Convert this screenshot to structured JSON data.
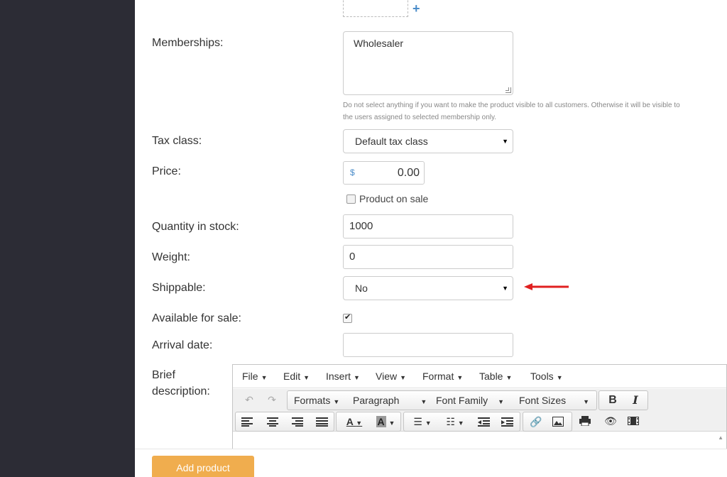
{
  "form": {
    "memberships_label": "Memberships:",
    "memberships_value": "Wholesaler",
    "memberships_hint": "Do not select anything if you want to make the product visible to all customers. Otherwise it will be visible to the users assigned to selected membership only.",
    "tax_class_label": "Tax class:",
    "tax_class_value": "Default tax class",
    "price_label": "Price:",
    "price_currency": "$",
    "price_value": "0.00",
    "on_sale_label": "Product on sale",
    "quantity_label": "Quantity in stock:",
    "quantity_value": "1000",
    "weight_label": "Weight:",
    "weight_value": "0",
    "shippable_label": "Shippable:",
    "shippable_value": "No",
    "available_label": "Available for sale:",
    "arrival_label": "Arrival date:",
    "arrival_value": "",
    "brief_label_line1": "Brief",
    "brief_label_line2": "description:",
    "add_image_symbol": "+"
  },
  "editor": {
    "menu": [
      "File",
      "Edit",
      "Insert",
      "View",
      "Format",
      "Table",
      "Tools"
    ],
    "toolbar": {
      "formats": "Formats",
      "paragraph": "Paragraph",
      "font_family": "Font Family",
      "font_sizes": "Font Sizes",
      "bold": "B",
      "italic": "I",
      "undo": "↶",
      "redo": "↷"
    }
  },
  "actions": {
    "add_product": "Add product"
  },
  "colors": {
    "sidebar": "#2c2c35",
    "accent_button": "#f0ad4e",
    "arrow": "#e02020",
    "link_blue": "#4a8cc9"
  },
  "icons": [
    "plus-icon",
    "dropdown-caret-icon",
    "checkmark-icon",
    "red-arrow-icon",
    "align-left-icon",
    "align-center-icon",
    "align-right-icon",
    "align-justify-icon",
    "text-color-icon",
    "background-color-icon",
    "bullet-list-icon",
    "numbered-list-icon",
    "outdent-icon",
    "indent-icon",
    "link-icon",
    "image-icon",
    "print-icon",
    "preview-icon",
    "media-icon"
  ]
}
